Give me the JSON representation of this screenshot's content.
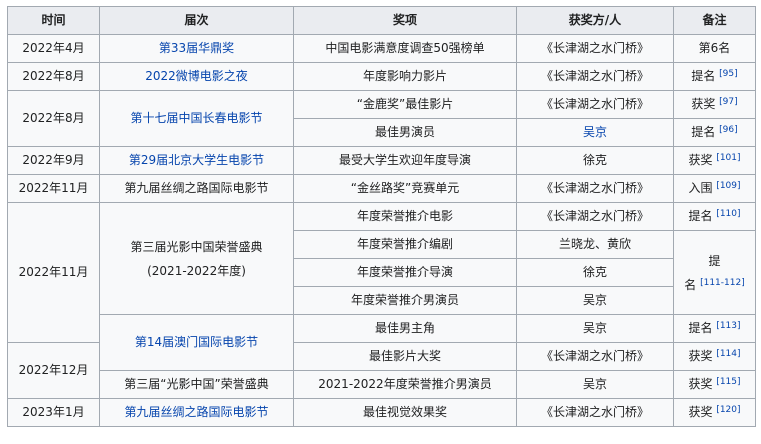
{
  "headers": {
    "time": "时间",
    "session": "届次",
    "award": "奖项",
    "winner": "获奖方/人",
    "note": "备注"
  },
  "rows": [
    {
      "time": "2022年4月",
      "session": "第33届华鼎奖",
      "award": "中国电影满意度调查50强榜单",
      "winner": "《长津湖之水门桥》",
      "note": "第6名",
      "ref": ""
    },
    {
      "time": "2022年8月",
      "session": "2022微博电影之夜",
      "award": "年度影响力影片",
      "winner": "《长津湖之水门桥》",
      "note": "提名",
      "ref": "[95]"
    },
    {
      "time": "2022年8月",
      "session": "第十七届中国长春电影节",
      "award": "“金鹿奖”最佳影片",
      "winner": "《长津湖之水门桥》",
      "note": "获奖",
      "ref": "[97]"
    },
    {
      "award": "最佳男演员",
      "winner": "吴京",
      "note": "提名",
      "ref": "[96]"
    },
    {
      "time": "2022年9月",
      "session": "第29届北京大学生电影节",
      "award": "最受大学生欢迎年度导演",
      "winner": "徐克",
      "note": "获奖",
      "ref": "[101]"
    },
    {
      "time": "2022年11月",
      "session": "第九届丝绸之路国际电影节",
      "award": "“金丝路奖”竞赛单元",
      "winner": "《长津湖之水门桥》",
      "note": "入围",
      "ref": "[109]"
    },
    {
      "time": "2022年11月",
      "session_line1": "第三届光影中国荣誉盛典",
      "session_line2": "(2021-2022年度)",
      "award": "年度荣誉推介电影",
      "winner": "《长津湖之水门桥》",
      "note": "提名",
      "ref": "[110]"
    },
    {
      "award": "年度荣誉推介编剧",
      "winner": "兰晓龙、黄欣",
      "note_line1": "提",
      "note_line2": "名",
      "ref": "[111-112]"
    },
    {
      "award": "年度荣誉推介导演",
      "winner": "徐克"
    },
    {
      "award": "年度荣誉推介男演员",
      "winner": "吴京"
    },
    {
      "session": "第14届澳门国际电影节",
      "award": "最佳男主角",
      "winner": "吴京",
      "note": "提名",
      "ref": "[113]"
    },
    {
      "time": "2022年12月",
      "award": "最佳影片大奖",
      "winner": "《长津湖之水门桥》",
      "note": "获奖",
      "ref": "[114]"
    },
    {
      "session": "第三届“光影中国”荣誉盛典",
      "award": "2021-2022年度荣誉推介男演员",
      "winner": "吴京",
      "note": "获奖",
      "ref": "[115]"
    },
    {
      "time": "2023年1月",
      "session": "第九届丝绸之路国际电影节",
      "award": "最佳视觉效果奖",
      "winner": "《长津湖之水门桥》",
      "note": "获奖",
      "ref": "[120]"
    }
  ]
}
